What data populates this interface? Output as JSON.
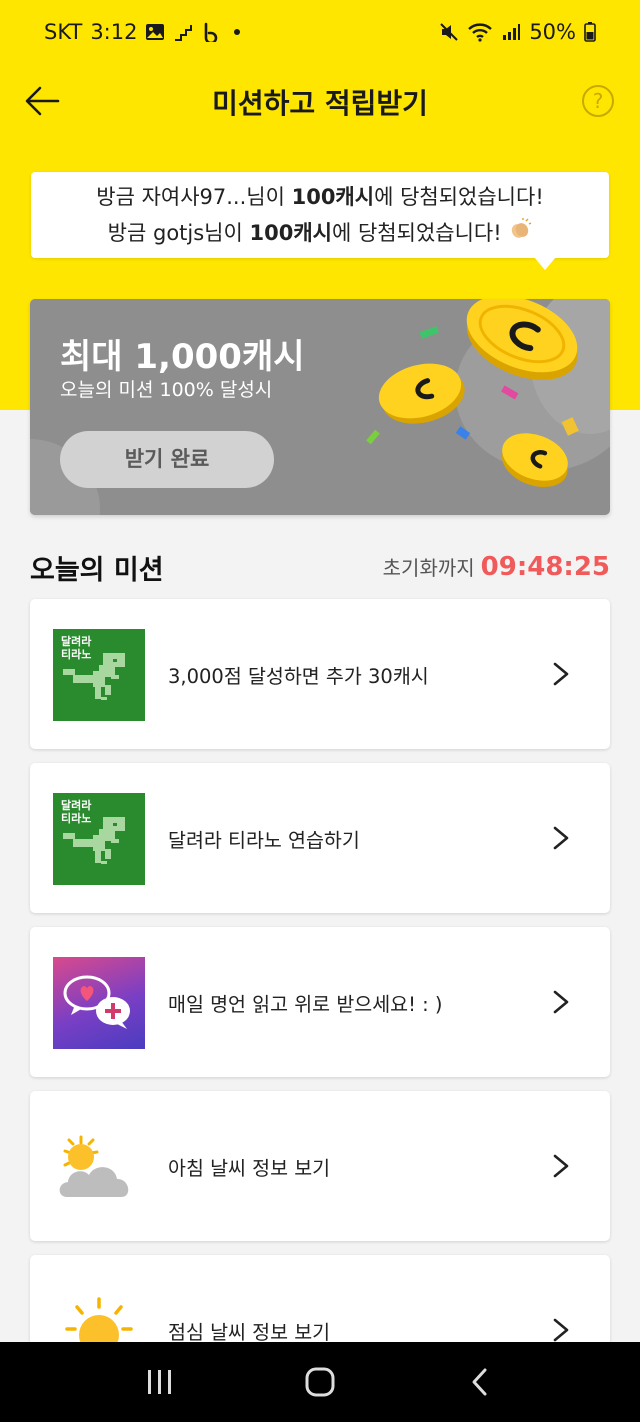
{
  "status_bar": {
    "carrier": "SKT",
    "time": "3:12",
    "battery": "50%"
  },
  "header": {
    "title": "미션하고 적립받기",
    "help_label": "?"
  },
  "winners": {
    "line1": {
      "prefix": "방금 자여사97...님이 ",
      "amount": "100캐시",
      "suffix": "에 당첨되었습니다!"
    },
    "line2": {
      "prefix": "방금 gotjs님이 ",
      "amount": "100캐시",
      "suffix": "에 당첨되었습니다!"
    }
  },
  "banner": {
    "title": "최대 1,000캐시",
    "subtitle": "오늘의 미션 100% 달성시",
    "button_label": "받기 완료"
  },
  "missions_section": {
    "title": "오늘의 미션",
    "reset_label": "초기화까지",
    "reset_time": "09:48:25"
  },
  "missions": [
    {
      "label": "3,000점 달성하면 추가 30캐시",
      "thumb_tag": [
        "달려라",
        "티라노"
      ],
      "icon": "dino-game-icon"
    },
    {
      "label": "달려라 티라노 연습하기",
      "thumb_tag": [
        "달려라",
        "티라노"
      ],
      "icon": "dino-game-icon"
    },
    {
      "label": "매일 명언 읽고 위로 받으세요! : )",
      "icon": "chat-heart-icon"
    },
    {
      "label": "아침 날씨 정보 보기",
      "icon": "partly-cloudy-icon"
    },
    {
      "label": "점심 날씨 정보 보기",
      "icon": "sun-icon"
    }
  ],
  "colors": {
    "brand_yellow": "#ffe600",
    "timer_red": "#f05a5a",
    "banner_gray": "#8e8e8e",
    "game_green": "#2a8a2e"
  }
}
